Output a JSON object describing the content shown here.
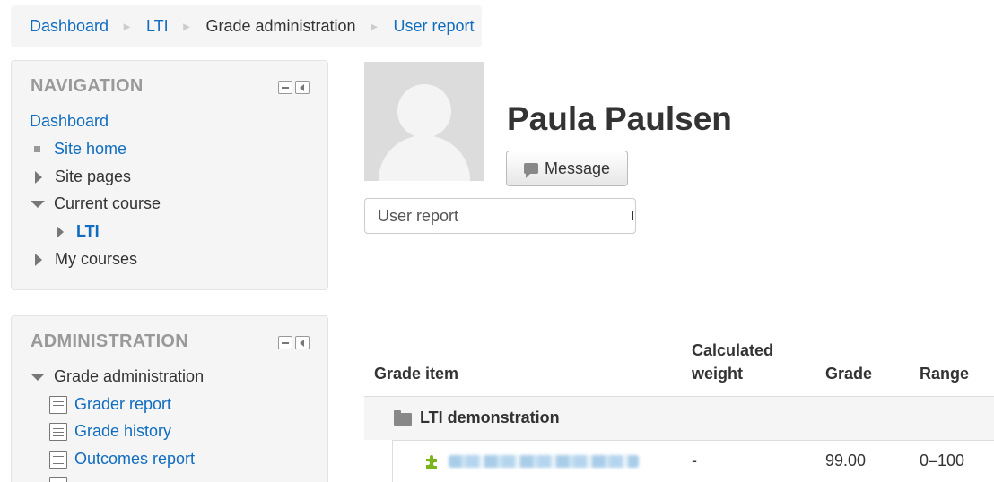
{
  "breadcrumb": {
    "items": [
      "Dashboard",
      "LTI",
      "Grade administration",
      "User report"
    ],
    "separator": "►"
  },
  "navigation": {
    "title": "NAVIGATION",
    "dashboard": "Dashboard",
    "site_home": "Site home",
    "site_pages": "Site pages",
    "current_course": "Current course",
    "course_lti": "LTI",
    "my_courses": "My courses"
  },
  "administration": {
    "title": "ADMINISTRATION",
    "grade_administration": "Grade administration",
    "grader_report": "Grader report",
    "grade_history": "Grade history",
    "outcomes_report": "Outcomes report"
  },
  "profile": {
    "name": "Paula Paulsen",
    "message_button": "Message"
  },
  "report_select": {
    "value": "User report"
  },
  "grade_table": {
    "headers": {
      "item": "Grade item",
      "weight_line1": "Calculated",
      "weight_line2": "weight",
      "grade": "Grade",
      "range": "Range"
    },
    "category": "LTI demonstration",
    "rows": [
      {
        "weight": "-",
        "grade": "99.00",
        "range": "0–100"
      }
    ]
  },
  "colors": {
    "link": "#0f6cbf",
    "block_bg": "#f5f5f5",
    "block_title": "#999999",
    "lti_icon": "#7ab51d"
  }
}
